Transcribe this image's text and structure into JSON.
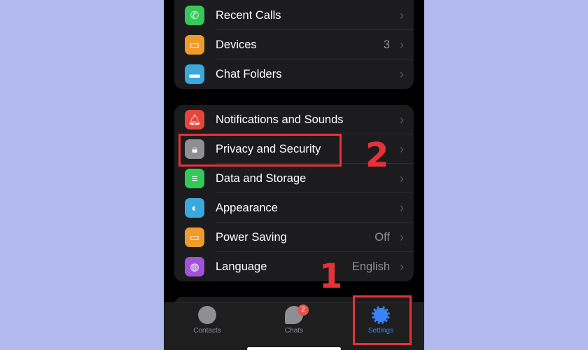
{
  "group1": [
    {
      "label": "Recent Calls",
      "icon": "phone-icon",
      "color": "#34c759"
    },
    {
      "label": "Devices",
      "value": "3",
      "icon": "devices-icon",
      "color": "#f09a2a"
    },
    {
      "label": "Chat Folders",
      "icon": "folder-icon",
      "color": "#3aa7dd"
    }
  ],
  "group2": [
    {
      "label": "Notifications and Sounds",
      "icon": "bell-icon",
      "color": "#e5453c"
    },
    {
      "label": "Privacy and Security",
      "icon": "lock-icon",
      "color": "#8e8e93"
    },
    {
      "label": "Data and Storage",
      "icon": "database-icon",
      "color": "#34c759"
    },
    {
      "label": "Appearance",
      "icon": "appearance-icon",
      "color": "#3aa7dd"
    },
    {
      "label": "Power Saving",
      "value": "Off",
      "icon": "battery-icon",
      "color": "#f09a2a"
    },
    {
      "label": "Language",
      "value": "English",
      "icon": "globe-icon",
      "color": "#a152d8"
    }
  ],
  "tabs": [
    {
      "label": "Contacts",
      "icon": "person-icon"
    },
    {
      "label": "Chats",
      "icon": "chat-bubbles-icon",
      "badge": "2"
    },
    {
      "label": "Settings",
      "icon": "gear-icon",
      "active": true
    }
  ],
  "annotations": {
    "step1": "1",
    "step2": "2",
    "highlight_color": "#e53238",
    "active_tab_color": "#3b82f6"
  }
}
